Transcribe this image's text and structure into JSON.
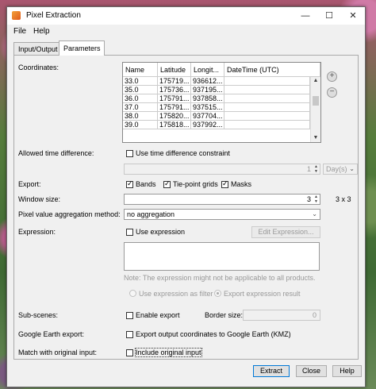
{
  "window": {
    "title": "Pixel Extraction"
  },
  "titlebar": {
    "minimize": "—",
    "maximize": "☐",
    "close": "✕"
  },
  "menu": {
    "file": "File",
    "help": "Help"
  },
  "tabs": [
    {
      "label": "Input/Output"
    },
    {
      "label": "Parameters"
    }
  ],
  "coordinates": {
    "label": "Coordinates:",
    "columns": [
      "Name",
      "Latitude",
      "Longit...",
      "DateTime (UTC)"
    ],
    "rows": [
      [
        "33.0",
        "175719...",
        "936612...",
        ""
      ],
      [
        "35.0",
        "175736...",
        "937195...",
        ""
      ],
      [
        "36.0",
        "175791...",
        "937858...",
        ""
      ],
      [
        "37.0",
        "175791...",
        "937515...",
        ""
      ],
      [
        "38.0",
        "175820...",
        "937704...",
        ""
      ],
      [
        "39.0",
        "175818...",
        "937992...",
        ""
      ]
    ]
  },
  "time_diff": {
    "label": "Allowed time difference:",
    "checkbox_label": "Use time difference constraint",
    "value": "1",
    "unit": "Day(s)"
  },
  "export": {
    "label": "Export:",
    "bands": "Bands",
    "tiepoints": "Tie-point grids",
    "masks": "Masks"
  },
  "window_size": {
    "label": "Window size:",
    "value": "3",
    "display": "3 x 3"
  },
  "aggregation": {
    "label": "Pixel value aggregation method:",
    "value": "no aggregation"
  },
  "expression": {
    "label": "Expression:",
    "checkbox_label": "Use expression",
    "button": "Edit Expression...",
    "note": "Note: The expression might not be applicable to all products.",
    "radio_filter": "Use expression as filter",
    "radio_export": "Export expression result"
  },
  "subscenes": {
    "label": "Sub-scenes:",
    "checkbox_label": "Enable export",
    "border_label": "Border size:",
    "border_value": "0"
  },
  "google_earth": {
    "label": "Google Earth export:",
    "checkbox_label": "Export output coordinates to Google Earth (KMZ)"
  },
  "match_input": {
    "label": "Match with original input:",
    "checkbox_label": "Include original input"
  },
  "buttons": {
    "extract": "Extract",
    "close": "Close",
    "help": "Help"
  }
}
